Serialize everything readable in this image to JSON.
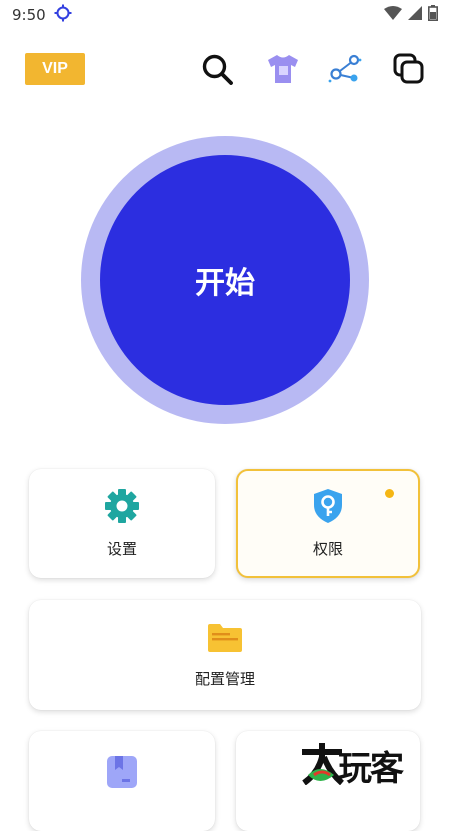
{
  "status_bar": {
    "time": "9:50"
  },
  "top_bar": {
    "vip_label": "VIP"
  },
  "start_button": {
    "label": "开始"
  },
  "cards": {
    "settings": {
      "label": "设置"
    },
    "permissions": {
      "label": "权限"
    },
    "config_manage": {
      "label": "配置管理"
    }
  },
  "watermark": {
    "text": "玩客"
  },
  "colors": {
    "accent": "#2c2ee0",
    "ring": "#b8b9f3",
    "vip": "#f2b630",
    "teal": "#1fa6a0",
    "shield_blue": "#3aa3ee",
    "folder_yellow": "#f7c233",
    "highlight_border": "#f2c13a"
  }
}
